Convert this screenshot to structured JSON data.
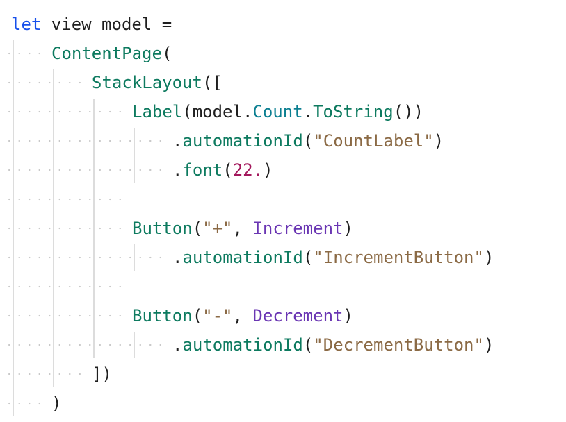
{
  "code_lines": [
    {
      "tokens": [
        {
          "t": "let",
          "c": "kw"
        },
        {
          "t": " view model =",
          "c": "plain"
        }
      ]
    },
    {
      "tokens": [
        {
          "t": "ContentPage",
          "c": "fn"
        },
        {
          "t": "(",
          "c": "plain"
        }
      ]
    },
    {
      "tokens": [
        {
          "t": "StackLayout",
          "c": "fn"
        },
        {
          "t": "([",
          "c": "plain"
        }
      ]
    },
    {
      "tokens": [
        {
          "t": "Label",
          "c": "fn"
        },
        {
          "t": "(model.",
          "c": "plain"
        },
        {
          "t": "Count",
          "c": "ty"
        },
        {
          "t": ".",
          "c": "plain"
        },
        {
          "t": "ToString",
          "c": "fn"
        },
        {
          "t": "())",
          "c": "plain"
        }
      ]
    },
    {
      "tokens": [
        {
          "t": ".",
          "c": "plain"
        },
        {
          "t": "automationId",
          "c": "fn"
        },
        {
          "t": "(",
          "c": "plain"
        },
        {
          "t": "\"CountLabel\"",
          "c": "str"
        },
        {
          "t": ")",
          "c": "plain"
        }
      ]
    },
    {
      "tokens": [
        {
          "t": ".",
          "c": "plain"
        },
        {
          "t": "font",
          "c": "fn"
        },
        {
          "t": "(",
          "c": "plain"
        },
        {
          "t": "22.",
          "c": "num"
        },
        {
          "t": ")",
          "c": "plain"
        }
      ]
    },
    {
      "tokens": []
    },
    {
      "tokens": [
        {
          "t": "Button",
          "c": "fn"
        },
        {
          "t": "(",
          "c": "plain"
        },
        {
          "t": "\"+\"",
          "c": "str"
        },
        {
          "t": ", ",
          "c": "plain"
        },
        {
          "t": "Increment",
          "c": "id"
        },
        {
          "t": ")",
          "c": "plain"
        }
      ]
    },
    {
      "tokens": [
        {
          "t": ".",
          "c": "plain"
        },
        {
          "t": "automationId",
          "c": "fn"
        },
        {
          "t": "(",
          "c": "plain"
        },
        {
          "t": "\"IncrementButton\"",
          "c": "str"
        },
        {
          "t": ")",
          "c": "plain"
        }
      ]
    },
    {
      "tokens": []
    },
    {
      "tokens": [
        {
          "t": "Button",
          "c": "fn"
        },
        {
          "t": "(",
          "c": "plain"
        },
        {
          "t": "\"-\"",
          "c": "str"
        },
        {
          "t": ", ",
          "c": "plain"
        },
        {
          "t": "Decrement",
          "c": "id"
        },
        {
          "t": ")",
          "c": "plain"
        }
      ]
    },
    {
      "tokens": [
        {
          "t": ".",
          "c": "plain"
        },
        {
          "t": "automationId",
          "c": "fn"
        },
        {
          "t": "(",
          "c": "plain"
        },
        {
          "t": "\"DecrementButton\"",
          "c": "str"
        },
        {
          "t": ")",
          "c": "plain"
        }
      ]
    },
    {
      "tokens": [
        {
          "t": "])",
          "c": "plain"
        }
      ]
    },
    {
      "tokens": [
        {
          "t": ")",
          "c": "plain"
        }
      ]
    }
  ],
  "colors": {
    "keyword": "#1750eb",
    "function": "#0d7a5f",
    "type": "#0b7f91",
    "string": "#8b6a45",
    "number": "#a3185c",
    "identifier": "#6a36b3",
    "text": "#1f1f1f",
    "background": "#ffffff"
  }
}
